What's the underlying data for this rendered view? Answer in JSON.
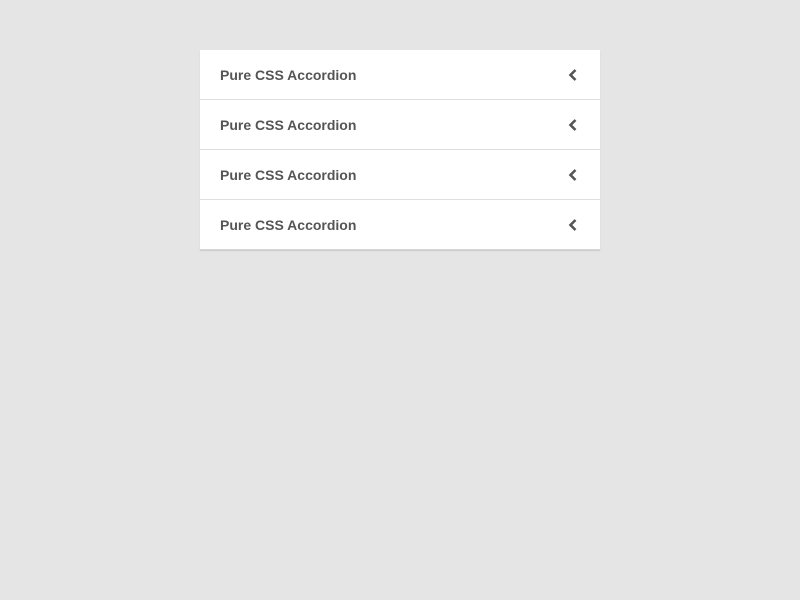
{
  "accordion": {
    "items": [
      {
        "label": "Pure CSS Accordion",
        "icon": "chevron-left-icon"
      },
      {
        "label": "Pure CSS Accordion",
        "icon": "chevron-left-icon"
      },
      {
        "label": "Pure CSS Accordion",
        "icon": "chevron-left-icon"
      },
      {
        "label": "Pure CSS Accordion",
        "icon": "chevron-left-icon"
      }
    ]
  },
  "colors": {
    "background": "#e5e5e5",
    "panel": "#ffffff",
    "text": "#555555",
    "divider": "#dedede"
  }
}
